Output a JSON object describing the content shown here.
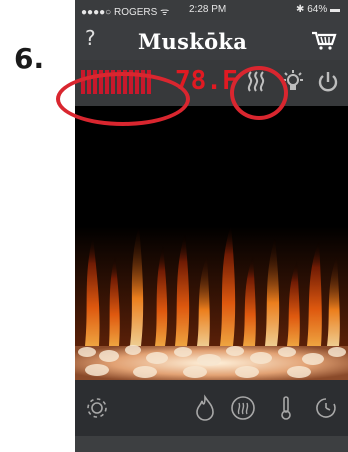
{
  "step_label": "6.",
  "status": {
    "carrier": "●●●●○ ROGERS ᯤ",
    "time": "2:28 PM",
    "battery": "✱ 64% ▬"
  },
  "nav": {
    "help": "?",
    "logo": "Muskōka",
    "cart_icon": "cart-icon"
  },
  "controls": {
    "level_bars": 12,
    "temperature": "78.F",
    "flame_heat_icon": "heat-waves-icon",
    "light_icon": "light-icon",
    "power_icon": "power-icon"
  },
  "footer": {
    "settings_icon": "gear-icon",
    "flame_icon": "flame-icon",
    "heat_icon": "heat-icon",
    "thermometer_icon": "thermometer-icon",
    "timer_icon": "timer-icon"
  },
  "colors": {
    "accent_red": "#e01a22",
    "annotation_red": "#d9262f",
    "bar_red": "#c8182b"
  }
}
